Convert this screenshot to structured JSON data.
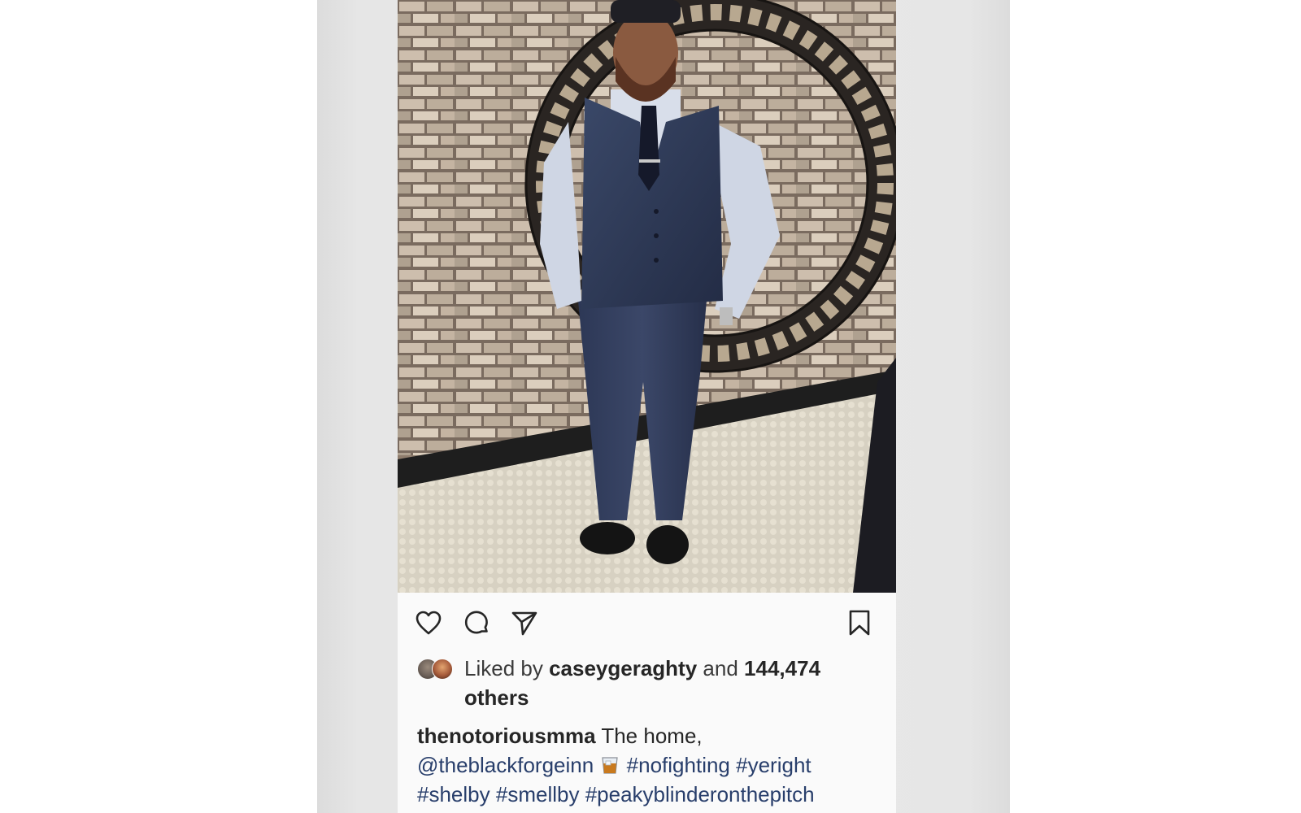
{
  "post": {
    "actions": {
      "like_icon": "heart-icon",
      "comment_icon": "comment-icon",
      "share_icon": "paper-plane-icon",
      "save_icon": "bookmark-icon"
    },
    "likes": {
      "prefix": "Liked by",
      "user": "caseygeraghty",
      "conjunction": "and",
      "count": "144,474",
      "suffix": "others"
    },
    "caption": {
      "username": "thenotoriousmma",
      "text": "The home,",
      "mention": "@theblackforgeinn",
      "emoji": "whiskey-glass-icon",
      "hashtags": [
        "#nofighting",
        "#yeright",
        "#shelby",
        "#smellby",
        "#peakyblinderonthepitch"
      ]
    }
  },
  "colors": {
    "text": "#262626",
    "link": "#283e6b",
    "background": "#fafafa",
    "side_panel": "#e6e6e6"
  }
}
